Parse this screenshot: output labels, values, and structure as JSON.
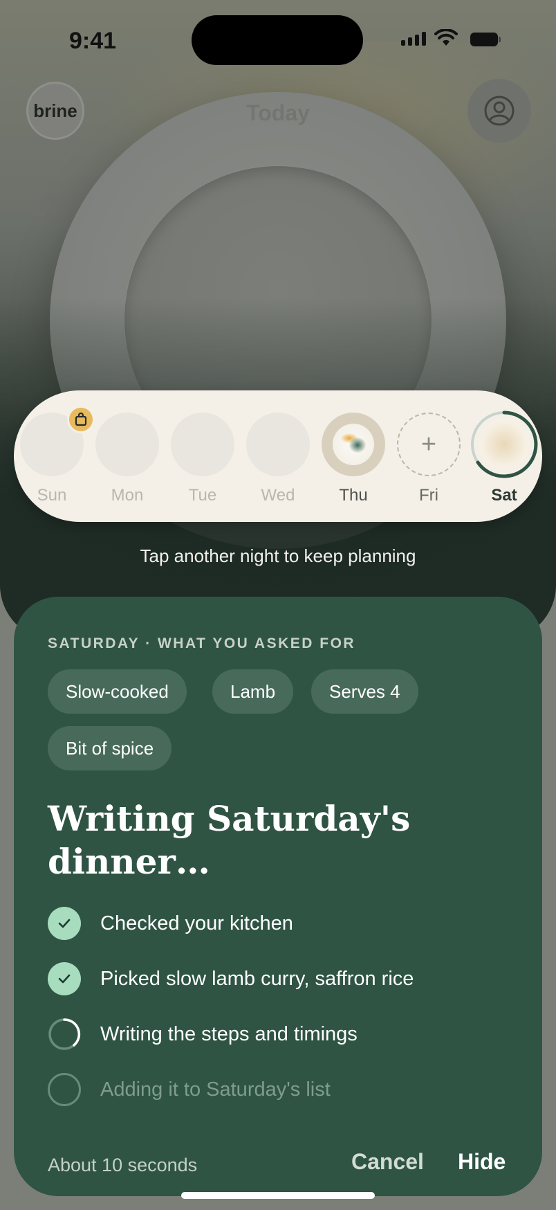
{
  "status_bar": {
    "time": "9:41"
  },
  "header": {
    "logo": "brine",
    "title": "Today"
  },
  "week": {
    "days": [
      {
        "label": "Sun",
        "state": "empty",
        "badge": "shopping-bag-icon"
      },
      {
        "label": "Mon",
        "state": "empty"
      },
      {
        "label": "Tue",
        "state": "empty"
      },
      {
        "label": "Wed",
        "state": "empty"
      },
      {
        "label": "Thu",
        "state": "planned"
      },
      {
        "label": "Fri",
        "state": "add"
      },
      {
        "label": "Sat",
        "state": "in-progress",
        "selected": true
      }
    ],
    "hint": "Tap another night to keep planning"
  },
  "sheet": {
    "eyebrow": "SATURDAY · WHAT YOU ASKED FOR",
    "chips": [
      "Slow-cooked",
      "Lamb",
      "Serves 4",
      "Bit of spice"
    ],
    "title": "Writing Saturday's dinner…",
    "steps": [
      {
        "text": "Checked your kitchen",
        "status": "done"
      },
      {
        "text": "Picked slow lamb curry, saffron rice",
        "status": "done"
      },
      {
        "text": "Writing the steps and timings",
        "status": "in-progress"
      },
      {
        "text": "Adding it to Saturday's list",
        "status": "pending"
      }
    ],
    "eta": "About 10 seconds",
    "cancel_label": "Cancel",
    "hide_label": "Hide"
  },
  "colors": {
    "sheet_bg": "#2f5444",
    "chip_bg": "#486a5b",
    "check_bg": "#a8dcbf",
    "strip_bg": "#f4f0e8",
    "badge": "#e8ba5e"
  }
}
